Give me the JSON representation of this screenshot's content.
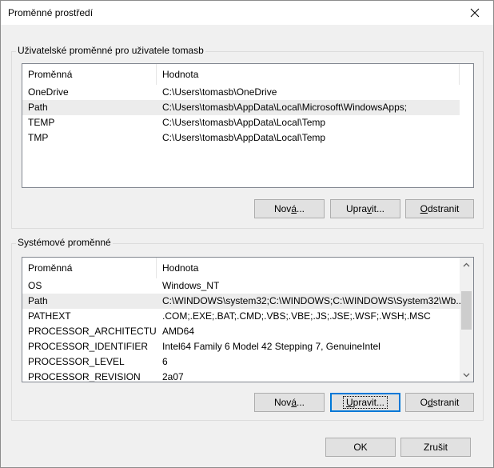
{
  "window": {
    "title": "Proměnné prostředí",
    "close_icon": "close-icon"
  },
  "user_vars": {
    "group_label": "Uživatelské proměnné pro uživatele tomasb",
    "columns": [
      "Proměnná",
      "Hodnota"
    ],
    "rows": [
      {
        "name": "OneDrive",
        "value": "C:\\Users\\tomasb\\OneDrive"
      },
      {
        "name": "Path",
        "value": "C:\\Users\\tomasb\\AppData\\Local\\Microsoft\\WindowsApps;"
      },
      {
        "name": "TEMP",
        "value": "C:\\Users\\tomasb\\AppData\\Local\\Temp"
      },
      {
        "name": "TMP",
        "value": "C:\\Users\\tomasb\\AppData\\Local\\Temp"
      }
    ],
    "selected_row": 1,
    "buttons": {
      "new": {
        "label": "Nová...",
        "mnemonic": "N"
      },
      "edit": {
        "label": "Upravit...",
        "mnemonic": "v"
      },
      "delete": {
        "label": "Odstranit",
        "mnemonic": "O"
      }
    }
  },
  "system_vars": {
    "group_label": "Systémové proměnné",
    "columns": [
      "Proměnná",
      "Hodnota"
    ],
    "rows": [
      {
        "name": "OS",
        "value": "Windows_NT"
      },
      {
        "name": "Path",
        "value": "C:\\WINDOWS\\system32;C:\\WINDOWS;C:\\WINDOWS\\System32\\Wb..."
      },
      {
        "name": "PATHEXT",
        "value": ".COM;.EXE;.BAT;.CMD;.VBS;.VBE;.JS;.JSE;.WSF;.WSH;.MSC"
      },
      {
        "name": "PROCESSOR_ARCHITECTURE",
        "value": "AMD64"
      },
      {
        "name": "PROCESSOR_IDENTIFIER",
        "value": "Intel64 Family 6 Model 42 Stepping 7, GenuineIntel"
      },
      {
        "name": "PROCESSOR_LEVEL",
        "value": "6"
      },
      {
        "name": "PROCESSOR_REVISION",
        "value": "2a07"
      }
    ],
    "selected_row": 1,
    "buttons": {
      "new": {
        "label": "Nová...",
        "mnemonic": "á"
      },
      "edit": {
        "label": "Upravit...",
        "mnemonic": "U"
      },
      "delete": {
        "label": "Odstranit",
        "mnemonic": "d"
      }
    }
  },
  "footer": {
    "ok": "OK",
    "cancel": "Zrušit"
  }
}
